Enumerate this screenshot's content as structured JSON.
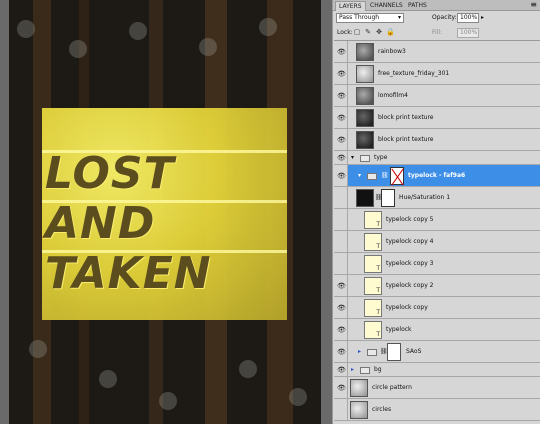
{
  "panel": {
    "tabs": [
      "LAYERS",
      "CHANNELS",
      "PATHS"
    ],
    "menu_icon": "panel-menu-icon",
    "blend_mode": "Pass Through",
    "opacity_label": "Opacity:",
    "opacity_value": "100%",
    "lock_label": "Lock:",
    "fill_label": "Fill:",
    "fill_value": "100%"
  },
  "layers": [
    {
      "name": "rainbow3",
      "visible": true,
      "kind": "image",
      "thumb": "mid"
    },
    {
      "name": "free_texture_friday_301",
      "visible": true,
      "kind": "image",
      "thumb": "light"
    },
    {
      "name": "lomofilm4",
      "visible": true,
      "kind": "image",
      "thumb": "mid"
    },
    {
      "name": "block print texture",
      "visible": true,
      "kind": "image",
      "thumb": "dark"
    },
    {
      "name": "block print texture",
      "visible": true,
      "kind": "image",
      "thumb": "dark"
    },
    {
      "name": "type",
      "visible": true,
      "kind": "group-open"
    },
    {
      "name": "typelock - faf9a6",
      "visible": true,
      "kind": "group-selected"
    },
    {
      "name": "Hue/Saturation 1",
      "visible": false,
      "kind": "adjustment"
    },
    {
      "name": "typelock copy 5",
      "visible": false,
      "kind": "type"
    },
    {
      "name": "typelock copy 4",
      "visible": false,
      "kind": "type"
    },
    {
      "name": "typelock copy 3",
      "visible": false,
      "kind": "type"
    },
    {
      "name": "typelock copy 2",
      "visible": true,
      "kind": "type"
    },
    {
      "name": "typelock copy",
      "visible": true,
      "kind": "type"
    },
    {
      "name": "typelock",
      "visible": true,
      "kind": "type"
    },
    {
      "name": "SAoS",
      "visible": true,
      "kind": "group-mask"
    },
    {
      "name": "bg",
      "visible": true,
      "kind": "group-closed"
    },
    {
      "name": "circle pattern",
      "visible": true,
      "kind": "image",
      "thumb": "light"
    },
    {
      "name": "circles",
      "visible": false,
      "kind": "image",
      "thumb": "light"
    }
  ],
  "artwork": {
    "lines": [
      "LOST",
      "AND",
      "TAKEN"
    ]
  }
}
